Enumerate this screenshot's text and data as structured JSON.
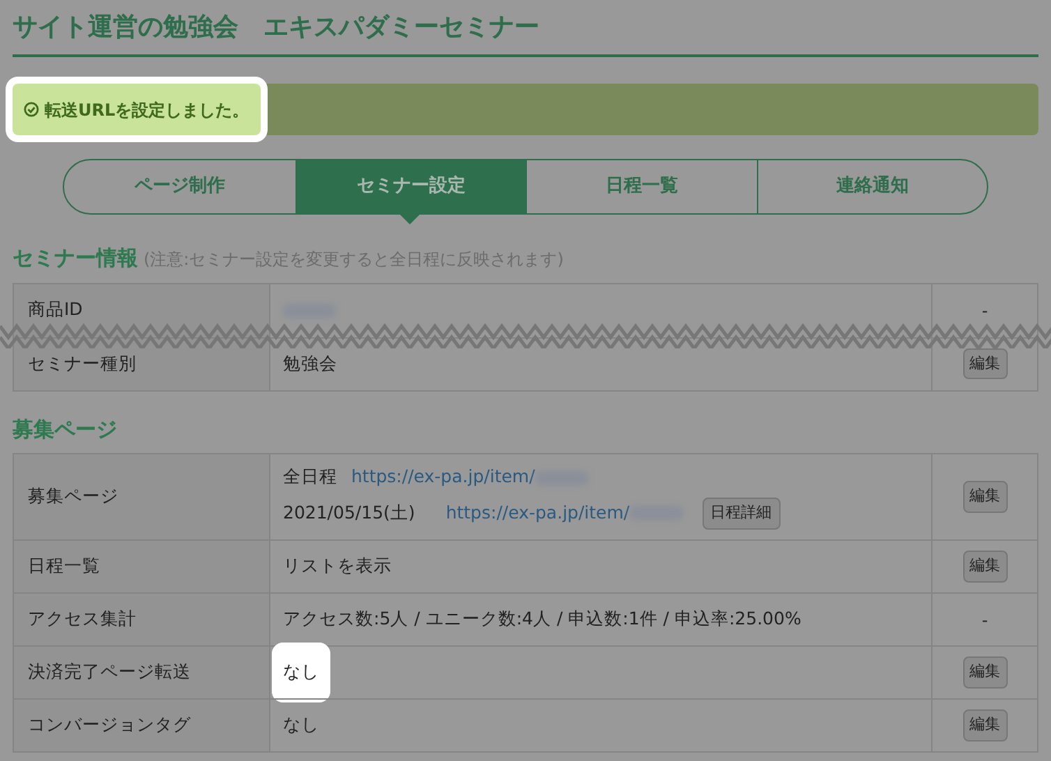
{
  "title": "サイト運営の勉強会　エキスパダミーセミナー",
  "notice": {
    "text": "転送URLを設定しました。",
    "highlighted": true
  },
  "tabs": [
    {
      "label": "ページ制作",
      "selected": false
    },
    {
      "label": "セミナー設定",
      "selected": true
    },
    {
      "label": "日程一覧",
      "selected": false
    },
    {
      "label": "連絡通知",
      "selected": false
    }
  ],
  "sections": [
    {
      "heading": "セミナー情報",
      "note": "(注意:セミナー設定を変更すると全日程に反映されます)",
      "rows": [
        {
          "label": "商品ID",
          "lines": [
            [
              {
                "kind": "redacted"
              }
            ]
          ],
          "action": {
            "kind": "text",
            "label": "-"
          },
          "torn": true
        },
        {
          "label": "セミナー種別",
          "lines": [
            [
              {
                "kind": "text",
                "text": "勉強会"
              }
            ]
          ],
          "action": {
            "kind": "button",
            "label": "編集"
          },
          "torn": false
        }
      ]
    },
    {
      "heading": "募集ページ",
      "rows": [
        {
          "label": "募集ページ",
          "lines": [
            [
              {
                "kind": "text",
                "text": "全日程"
              },
              {
                "kind": "link",
                "text": "https://ex-pa.jp/item/"
              },
              {
                "kind": "redacted"
              }
            ],
            [
              {
                "kind": "text",
                "text": "2021/05/15(土)"
              },
              {
                "kind": "link",
                "text": "https://ex-pa.jp/item/"
              },
              {
                "kind": "redacted"
              },
              {
                "kind": "button",
                "text": "日程詳細"
              }
            ]
          ],
          "action": {
            "kind": "button",
            "label": "編集"
          }
        },
        {
          "label": "日程一覧",
          "lines": [
            [
              {
                "kind": "text",
                "text": "リストを表示"
              }
            ]
          ],
          "action": {
            "kind": "button",
            "label": "編集"
          }
        },
        {
          "label": "アクセス集計",
          "lines": [
            [
              {
                "kind": "text",
                "text": "アクセス数:5人 / ユニーク数:4人 / 申込数:1件 / 申込率:25.00%"
              }
            ]
          ],
          "action": {
            "kind": "text",
            "label": "-"
          }
        },
        {
          "label": "決済完了ページ転送",
          "lines": [
            [
              {
                "kind": "text",
                "text": "なし"
              }
            ]
          ],
          "action": {
            "kind": "button",
            "label": "編集"
          },
          "highlighted": true
        },
        {
          "label": "コンバージョンタグ",
          "lines": [
            [
              {
                "kind": "text",
                "text": "なし"
              }
            ]
          ],
          "action": {
            "kind": "button",
            "label": "編集"
          },
          "highlighted": false
        }
      ]
    }
  ]
}
